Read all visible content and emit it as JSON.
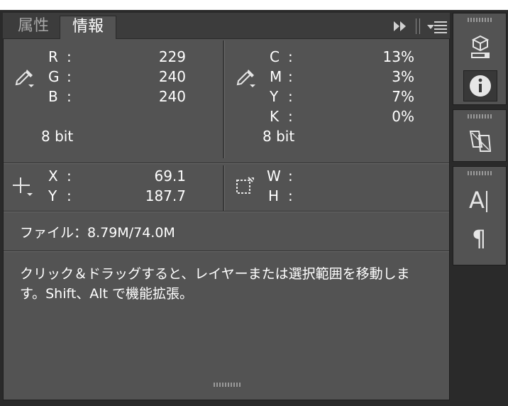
{
  "tabs": [
    {
      "label": "属性",
      "active": false
    },
    {
      "label": "情報",
      "active": true
    }
  ],
  "rgb": {
    "rows": [
      {
        "label": "R",
        "value": "229"
      },
      {
        "label": "G",
        "value": "240"
      },
      {
        "label": "B",
        "value": "240"
      }
    ],
    "bit_depth": "8 bit"
  },
  "cmyk": {
    "rows": [
      {
        "label": "C",
        "value": "13%"
      },
      {
        "label": "M",
        "value": "3%"
      },
      {
        "label": "Y",
        "value": "7%"
      },
      {
        "label": "K",
        "value": "0%"
      }
    ],
    "bit_depth": "8 bit"
  },
  "position": {
    "rows": [
      {
        "label": "X",
        "value": "69.1"
      },
      {
        "label": "Y",
        "value": "187.7"
      }
    ]
  },
  "size": {
    "rows": [
      {
        "label": "W",
        "value": ""
      },
      {
        "label": "H",
        "value": ""
      }
    ]
  },
  "colon": ":",
  "file_info": "ファイル：8.79M/74.0M",
  "hint": {
    "line1": "クリック＆ドラッグすると、レイヤーまたは選択範囲を移動しま",
    "line2": "す。Shift、Alt で機能拡張。"
  },
  "sidebar": {
    "text_icon_glyph": "A",
    "paragraph_icon_glyph": "¶"
  },
  "colors": {
    "panel_bg": "#535353",
    "tabbar_bg": "#3c3c3c",
    "frame_bg": "#2a2a2a",
    "text": "#ffffff"
  }
}
